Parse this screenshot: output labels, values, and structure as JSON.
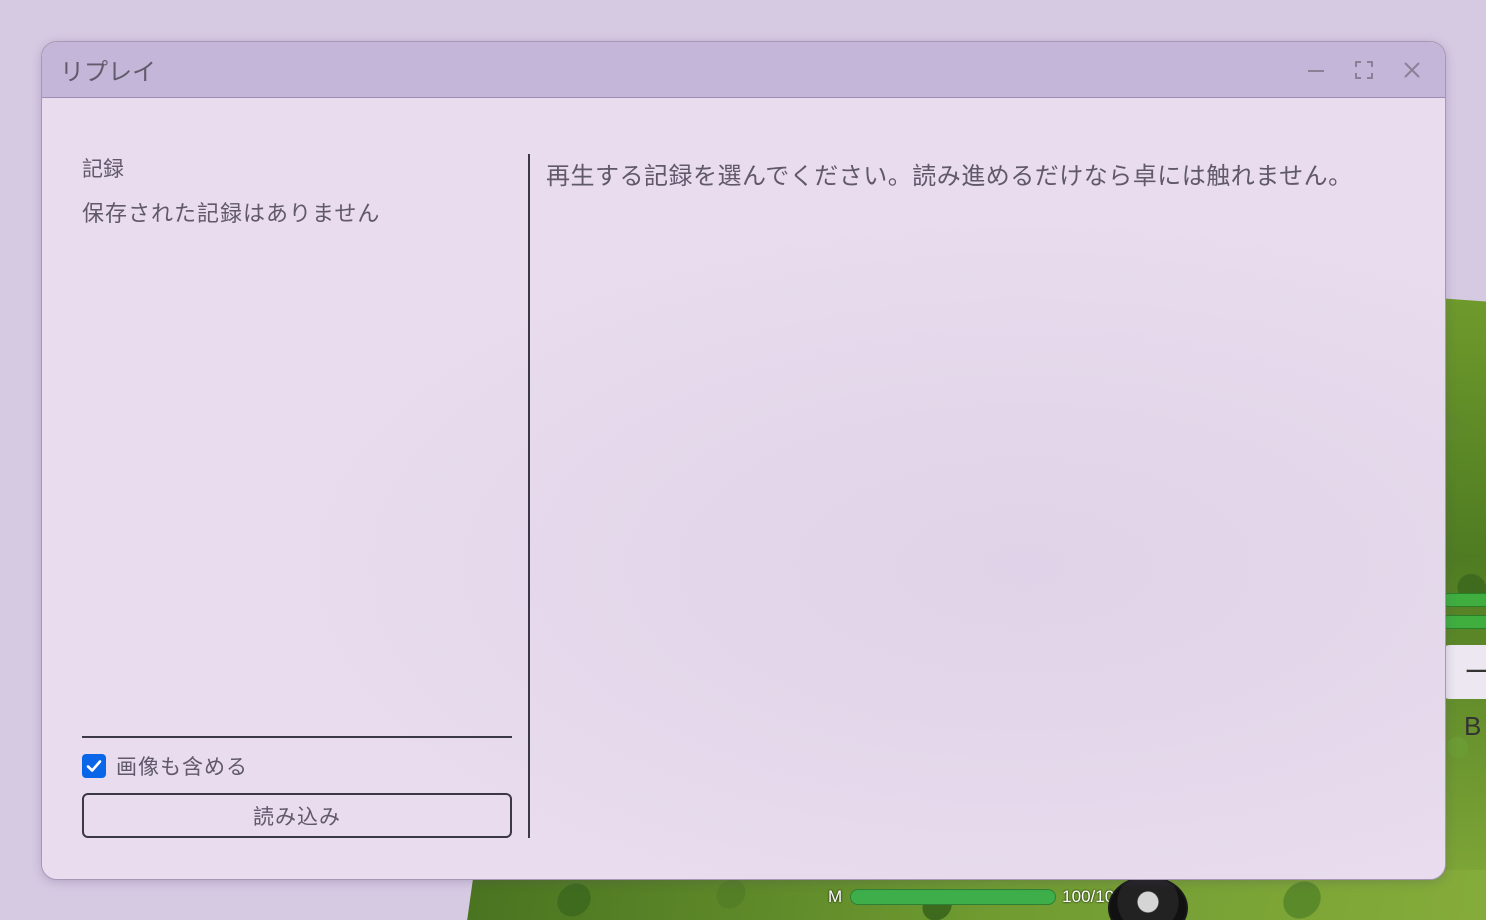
{
  "dialog": {
    "title": "リプレイ",
    "controls": {
      "minimize": "minimize-icon",
      "maximize": "maximize-icon",
      "close": "close-icon"
    }
  },
  "records": {
    "section_label": "記録",
    "empty_message": "保存された記録はありません",
    "include_images_label": "画像も含める",
    "include_images_checked": true,
    "load_button_label": "読み込み"
  },
  "instruction": "再生する記録を選んでください。読み進めるだけなら卓には触れません。",
  "background": {
    "side_label": "ーB",
    "hud": {
      "label": "M",
      "value": "100/100",
      "fill_fraction": 1.0,
      "bar_color": "#3eae4a"
    }
  },
  "colors": {
    "accent": "#0a66e8",
    "titlebar": "#c4b6d8",
    "window_bg": "#e8dcee",
    "text": "#5f596a"
  }
}
